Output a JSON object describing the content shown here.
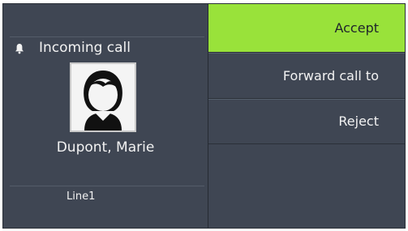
{
  "call": {
    "status": "Incoming call",
    "caller_name": "Dupont, Marie",
    "line": "Line1"
  },
  "actions": {
    "accept": "Accept",
    "forward": "Forward call to",
    "reject": "Reject"
  },
  "colors": {
    "background": "#3f4653",
    "accept_highlight": "#99e23a",
    "text": "#f2f2f2"
  },
  "icons": {
    "status": "bell-icon",
    "caller": "person-avatar"
  }
}
